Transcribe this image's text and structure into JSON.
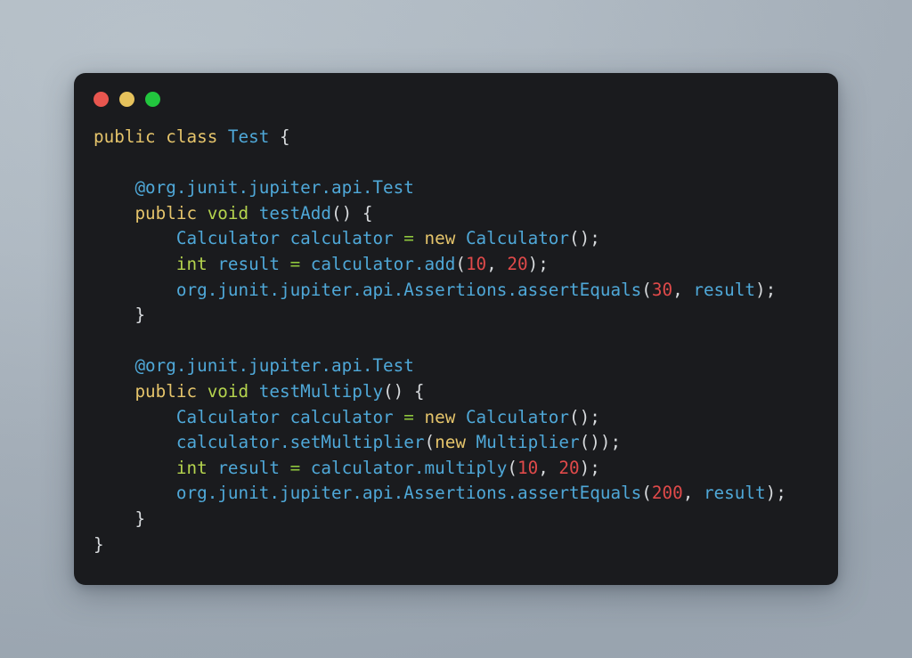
{
  "window": {
    "background_color": "#1a1b1e",
    "traffic_lights": [
      {
        "name": "close",
        "color": "#e8564f"
      },
      {
        "name": "minimize",
        "color": "#e6c25c"
      },
      {
        "name": "zoom",
        "color": "#22c63e"
      }
    ]
  },
  "theme": {
    "page_background": "#aab4bd",
    "keyword_color": "#e5c46b",
    "type_color": "#b5d44e",
    "identifier_color": "#4fa8d8",
    "number_color": "#e04a4a",
    "operator_color": "#8fc63d",
    "punctuation_color": "#d7dadd"
  },
  "code": {
    "language": "java",
    "class_name": "Test",
    "lines": [
      {
        "n": 1,
        "text": "public class Test {"
      },
      {
        "n": 2,
        "text": ""
      },
      {
        "n": 3,
        "text": "    @org.junit.jupiter.api.Test"
      },
      {
        "n": 4,
        "text": "    public void testAdd() {"
      },
      {
        "n": 5,
        "text": "        Calculator calculator = new Calculator();"
      },
      {
        "n": 6,
        "text": "        int result = calculator.add(10, 20);"
      },
      {
        "n": 7,
        "text": "        org.junit.jupiter.api.Assertions.assertEquals(30, result);"
      },
      {
        "n": 8,
        "text": "    }"
      },
      {
        "n": 9,
        "text": ""
      },
      {
        "n": 10,
        "text": "    @org.junit.jupiter.api.Test"
      },
      {
        "n": 11,
        "text": "    public void testMultiply() {"
      },
      {
        "n": 12,
        "text": "        Calculator calculator = new Calculator();"
      },
      {
        "n": 13,
        "text": "        calculator.setMultiplier(new Multiplier());"
      },
      {
        "n": 14,
        "text": "        int result = calculator.multiply(10, 20);"
      },
      {
        "n": 15,
        "text": "        org.junit.jupiter.api.Assertions.assertEquals(200, result);"
      },
      {
        "n": 16,
        "text": "    }"
      },
      {
        "n": 17,
        "text": "}"
      }
    ],
    "tokens": {
      "keywords": [
        "public",
        "class",
        "new"
      ],
      "types": [
        "int",
        "void"
      ],
      "identifiers": [
        "Test",
        "Calculator",
        "calculator",
        "result",
        "testAdd",
        "testMultiply",
        "setMultiplier",
        "Multiplier",
        "add",
        "multiply",
        "assertEquals",
        "Assertions",
        "org",
        "junit",
        "jupiter",
        "api"
      ],
      "annotations": [
        "@org.junit.jupiter.api.Test"
      ],
      "numbers": [
        "10",
        "20",
        "30",
        "200"
      ]
    }
  }
}
